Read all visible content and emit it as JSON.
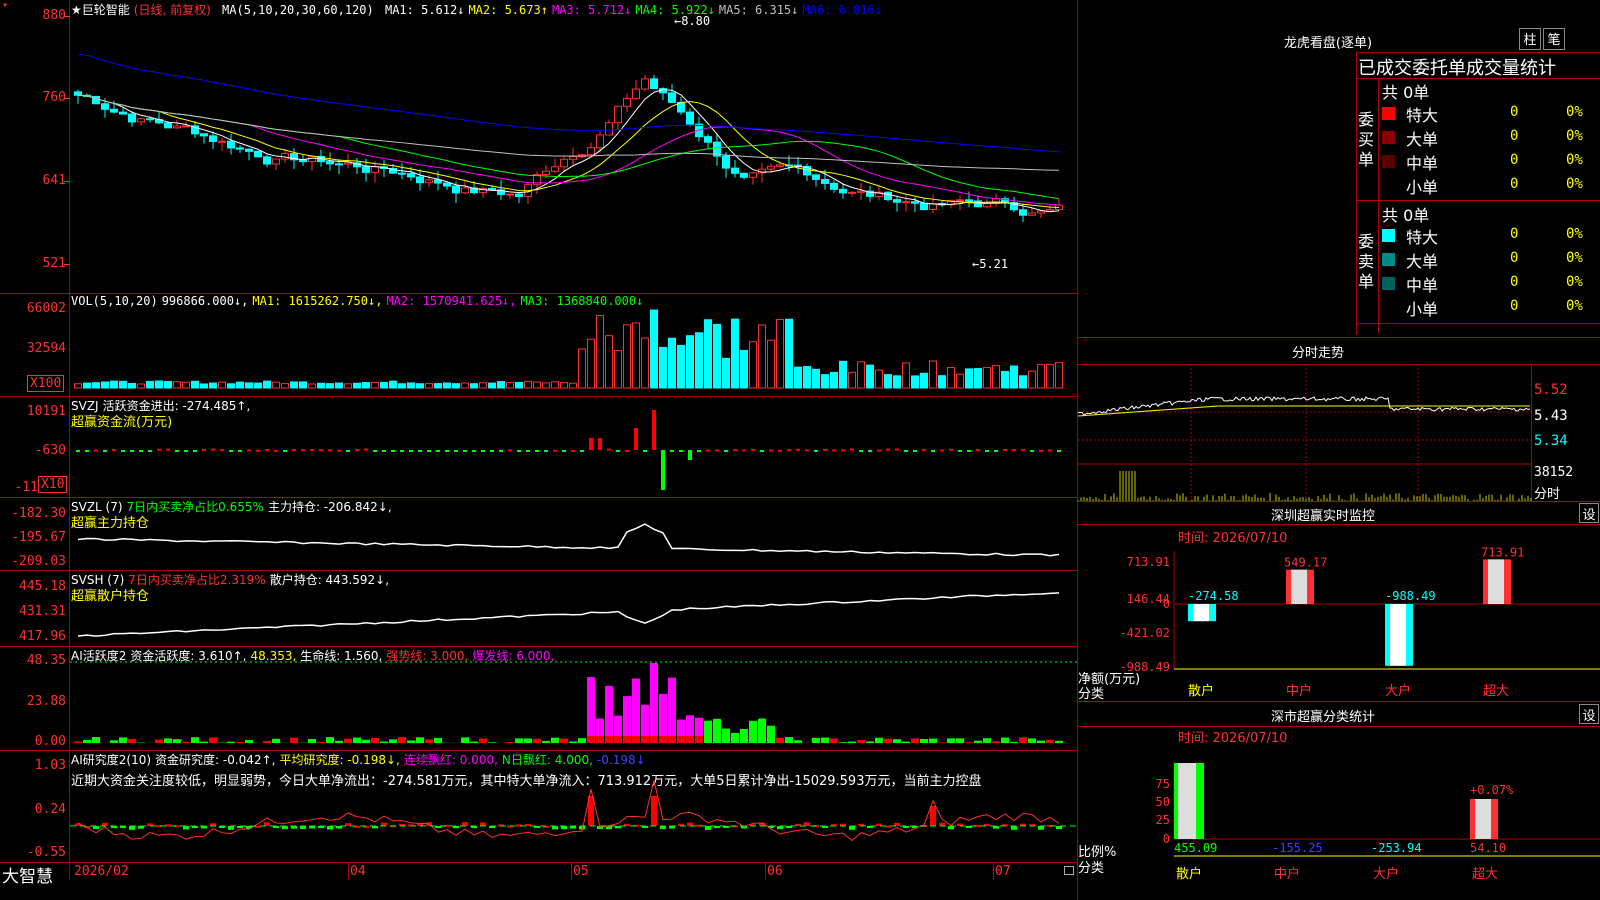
{
  "app": {
    "brand": "大智慧",
    "title_prefix": "★",
    "stock_name": "巨轮智能",
    "period": "(日线, 前复权)"
  },
  "main_chart": {
    "ma_params": "MA(5,10,20,30,60,120)",
    "ma": [
      {
        "label": "MA1:",
        "value": "5.612",
        "arrow": "↓",
        "color": "#ffffff"
      },
      {
        "label": "MA2:",
        "value": "5.673",
        "arrow": "↑",
        "color": "#ffff00"
      },
      {
        "label": "MA3:",
        "value": "5.712",
        "arrow": "↓",
        "color": "#ff00ff"
      },
      {
        "label": "MA4:",
        "value": "5.922",
        "arrow": "↓",
        "color": "#00ff00"
      },
      {
        "label": "MA5:",
        "value": "6.315",
        "arrow": "↓",
        "color": "#c0c0c0"
      },
      {
        "label": "MA6:",
        "value": "6.816",
        "arrow": "↓",
        "color": "#0000ff"
      }
    ],
    "y_labels": [
      "880",
      "760",
      "641",
      "521"
    ],
    "high_label": "8.80",
    "low_label": "5.21"
  },
  "vol_panel": {
    "header": [
      {
        "text": "VOL(5,10,20)",
        "color": "#ffffff"
      },
      {
        "text": "996866.000↓,",
        "color": "#ffffff"
      },
      {
        "text": "MA1: 1615262.750↓,",
        "color": "#ffff00"
      },
      {
        "text": "MA2: 1570941.625↓,",
        "color": "#ff00ff"
      },
      {
        "text": "MA3: 1368840.000↓",
        "color": "#00ff00"
      }
    ],
    "y_labels": [
      "66002",
      "32594"
    ],
    "unit": "X100"
  },
  "svzj_panel": {
    "header": [
      {
        "text": "SVZJ",
        "color": "#ffffff"
      },
      {
        "text": "活跃资金进出: -274.485↑,",
        "color": "#ffffff"
      }
    ],
    "subtitle": "超赢资金流(万元)",
    "y_labels": [
      "10191",
      "-630",
      "-11"
    ],
    "unit": "X10"
  },
  "svzl_panel": {
    "header": [
      {
        "text": "SVZL (7)",
        "color": "#ffffff"
      },
      {
        "text": "7日内买卖净占比0.655%",
        "color": "#00ff00"
      },
      {
        "text": "主力持仓: -206.842↓,",
        "color": "#ffffff"
      }
    ],
    "subtitle": "超赢主力持仓",
    "y_labels": [
      "-182.30",
      "-195.67",
      "-209.03"
    ]
  },
  "svsh_panel": {
    "header": [
      {
        "text": "SVSH (7)",
        "color": "#ffffff"
      },
      {
        "text": "7日内买卖净占比2.319%",
        "color": "#ff3030"
      },
      {
        "text": "散户持仓: 443.592↓,",
        "color": "#ffffff"
      }
    ],
    "subtitle": "超赢散户持仓",
    "y_labels": [
      "445.18",
      "431.31",
      "417.96"
    ]
  },
  "ai_active_panel": {
    "header": [
      {
        "text": "AI活跃度2",
        "color": "#ffffff"
      },
      {
        "text": "资金活跃度: 3.610↑,",
        "color": "#ffffff"
      },
      {
        "text": "48.353,",
        "color": "#ffff00"
      },
      {
        "text": "生命线: 1.560,",
        "color": "#ffffff"
      },
      {
        "text": "强势线: 3.000,",
        "color": "#ff3030"
      },
      {
        "text": "爆发线: 6.000,",
        "color": "#ff00ff"
      }
    ],
    "y_labels": [
      "48.35",
      "23.88",
      "0.00"
    ]
  },
  "ai_research_panel": {
    "header": [
      {
        "text": "AI研究度2(10)",
        "color": "#ffffff"
      },
      {
        "text": "资金研究度: -0.042↑,",
        "color": "#ffffff"
      },
      {
        "text": "平均研究度: -0.198↓,",
        "color": "#ffff00"
      },
      {
        "text": "连续飘红: 0.000,",
        "color": "#ff00ff"
      },
      {
        "text": "N日飘红: 4.000,",
        "color": "#00ff00"
      },
      {
        "text": "-0.198↓",
        "color": "#4040ff"
      }
    ],
    "commentary": "近期大资金关注度较低，明显弱势，今日大单净流出：-274.581万元，其中特大单净流入：713.912万元，大单5日累计净出-15029.593万元，当前主力控盘",
    "y_labels": [
      "1.03",
      "0.24",
      "-0.55"
    ]
  },
  "x_axis": [
    "2026/02",
    "04",
    "05",
    "06",
    "07"
  ],
  "longhu": {
    "title": "龙虎看盘(逐单)",
    "btn_a": "柱",
    "btn_b": "笔",
    "header": "已成交委托单成交量统计",
    "buy": {
      "side_label": "委买单",
      "total": "共 0单",
      "rows": [
        {
          "label": "特大",
          "count": "0",
          "pct": "0%",
          "color": "#ff0000"
        },
        {
          "label": "大单",
          "count": "0",
          "pct": "0%",
          "color": "#8b0000"
        },
        {
          "label": "中单",
          "count": "0",
          "pct": "0%",
          "color": "#5a0000"
        },
        {
          "label": "小单",
          "count": "0",
          "pct": "0%",
          "color": "#000000"
        }
      ]
    },
    "sell": {
      "side_label": "委卖单",
      "total": "共 0单",
      "rows": [
        {
          "label": "特大",
          "count": "0",
          "pct": "0%",
          "color": "#00ffff"
        },
        {
          "label": "大单",
          "count": "0",
          "pct": "0%",
          "color": "#008b8b"
        },
        {
          "label": "中单",
          "count": "0",
          "pct": "0%",
          "color": "#006060"
        },
        {
          "label": "小单",
          "count": "0",
          "pct": "0%",
          "color": "#000000"
        }
      ]
    }
  },
  "intraday": {
    "title": "分时走势",
    "price_labels": [
      "5.52",
      "5.43",
      "5.34"
    ],
    "vol_label": "38152",
    "vol_unit": "分时"
  },
  "sz_monitor": {
    "title": "深圳超赢实时监控",
    "settings": "设",
    "time": "时间: 2026/07/10",
    "y_labels": [
      "713.91",
      "146.44",
      "0",
      "-421.02",
      "-988.49"
    ],
    "axis_title": "净额(万元)",
    "axis_sub": "分类",
    "categories": [
      "散户",
      "中户",
      "大户",
      "超大"
    ],
    "values": [
      -274.58,
      549.17,
      -988.49,
      713.91
    ],
    "value_labels": [
      "-274.58",
      "549.17",
      "-988.49",
      "713.91"
    ]
  },
  "sz_classify": {
    "title": "深市超赢分类统计",
    "settings": "设",
    "time": "时间: 2026/07/10",
    "y_labels": [
      "75",
      "50",
      "25",
      "0"
    ],
    "axis_title": "比例%",
    "axis_sub": "分类",
    "categories": [
      "散户",
      "中户",
      "大户",
      "超大"
    ],
    "values": [
      "455.09",
      "-155.25",
      "-253.94",
      "54.10"
    ],
    "bar_pct_label": "+0.07%"
  }
}
